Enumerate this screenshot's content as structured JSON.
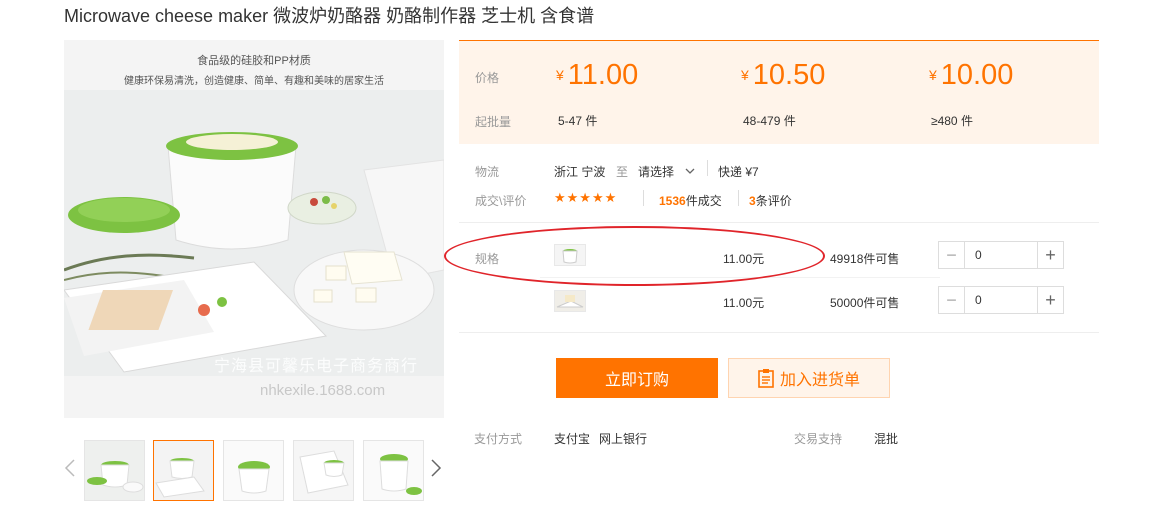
{
  "title": "Microwave cheese maker 微波炉奶酪器 奶酪制作器 芝士机 含食谱",
  "main_image": {
    "tagline_1": "食品级的硅胶和PP材质",
    "tagline_2": "健康环保易清洗，创造健康、简单、有趣和美味的居家生活",
    "watermark_shop": "宁海县可馨乐电子商务商行",
    "watermark_url": "nhkexile.1688.com"
  },
  "thumbnails": {
    "count": 5,
    "active_index": 1,
    "prev_icon": "chevron-left-icon",
    "next_icon": "chevron-right-icon"
  },
  "price_box": {
    "price_label": "价格",
    "moq_label": "起批量",
    "currency": "¥",
    "tiers": [
      {
        "price": "11.00",
        "range": "5-47 件"
      },
      {
        "price": "10.50",
        "range": "48-479 件"
      },
      {
        "price": "10.00",
        "range": "≥480 件"
      }
    ]
  },
  "logistics": {
    "label": "物流",
    "from": "浙江 宁波",
    "to_word": "至",
    "to_select": "请选择",
    "shipping": "快递 ¥7"
  },
  "reviews": {
    "label": "成交\\评价",
    "stars": "★★★★★",
    "rating": 4.5,
    "deals_count": "1536",
    "deals_suffix": "件成交",
    "review_count": "3",
    "review_suffix": "条评价"
  },
  "spec": {
    "label": "规格",
    "rows": [
      {
        "price": "11.00元",
        "stock": "49918件可售",
        "qty": "0"
      },
      {
        "price": "11.00元",
        "stock": "50000件可售",
        "qty": "0"
      }
    ]
  },
  "actions": {
    "order": "立即订购",
    "add_cart": "加入进货单"
  },
  "footer": {
    "payment_label": "支付方式",
    "payment_1": "支付宝",
    "payment_2": "网上银行",
    "trade_label": "交易支持",
    "trade_value": "混批"
  },
  "colors": {
    "accent": "#ff7300",
    "price_bg": "#fff4ea",
    "highlight_oval": "#e0242a",
    "product_green": "#7dc242"
  }
}
